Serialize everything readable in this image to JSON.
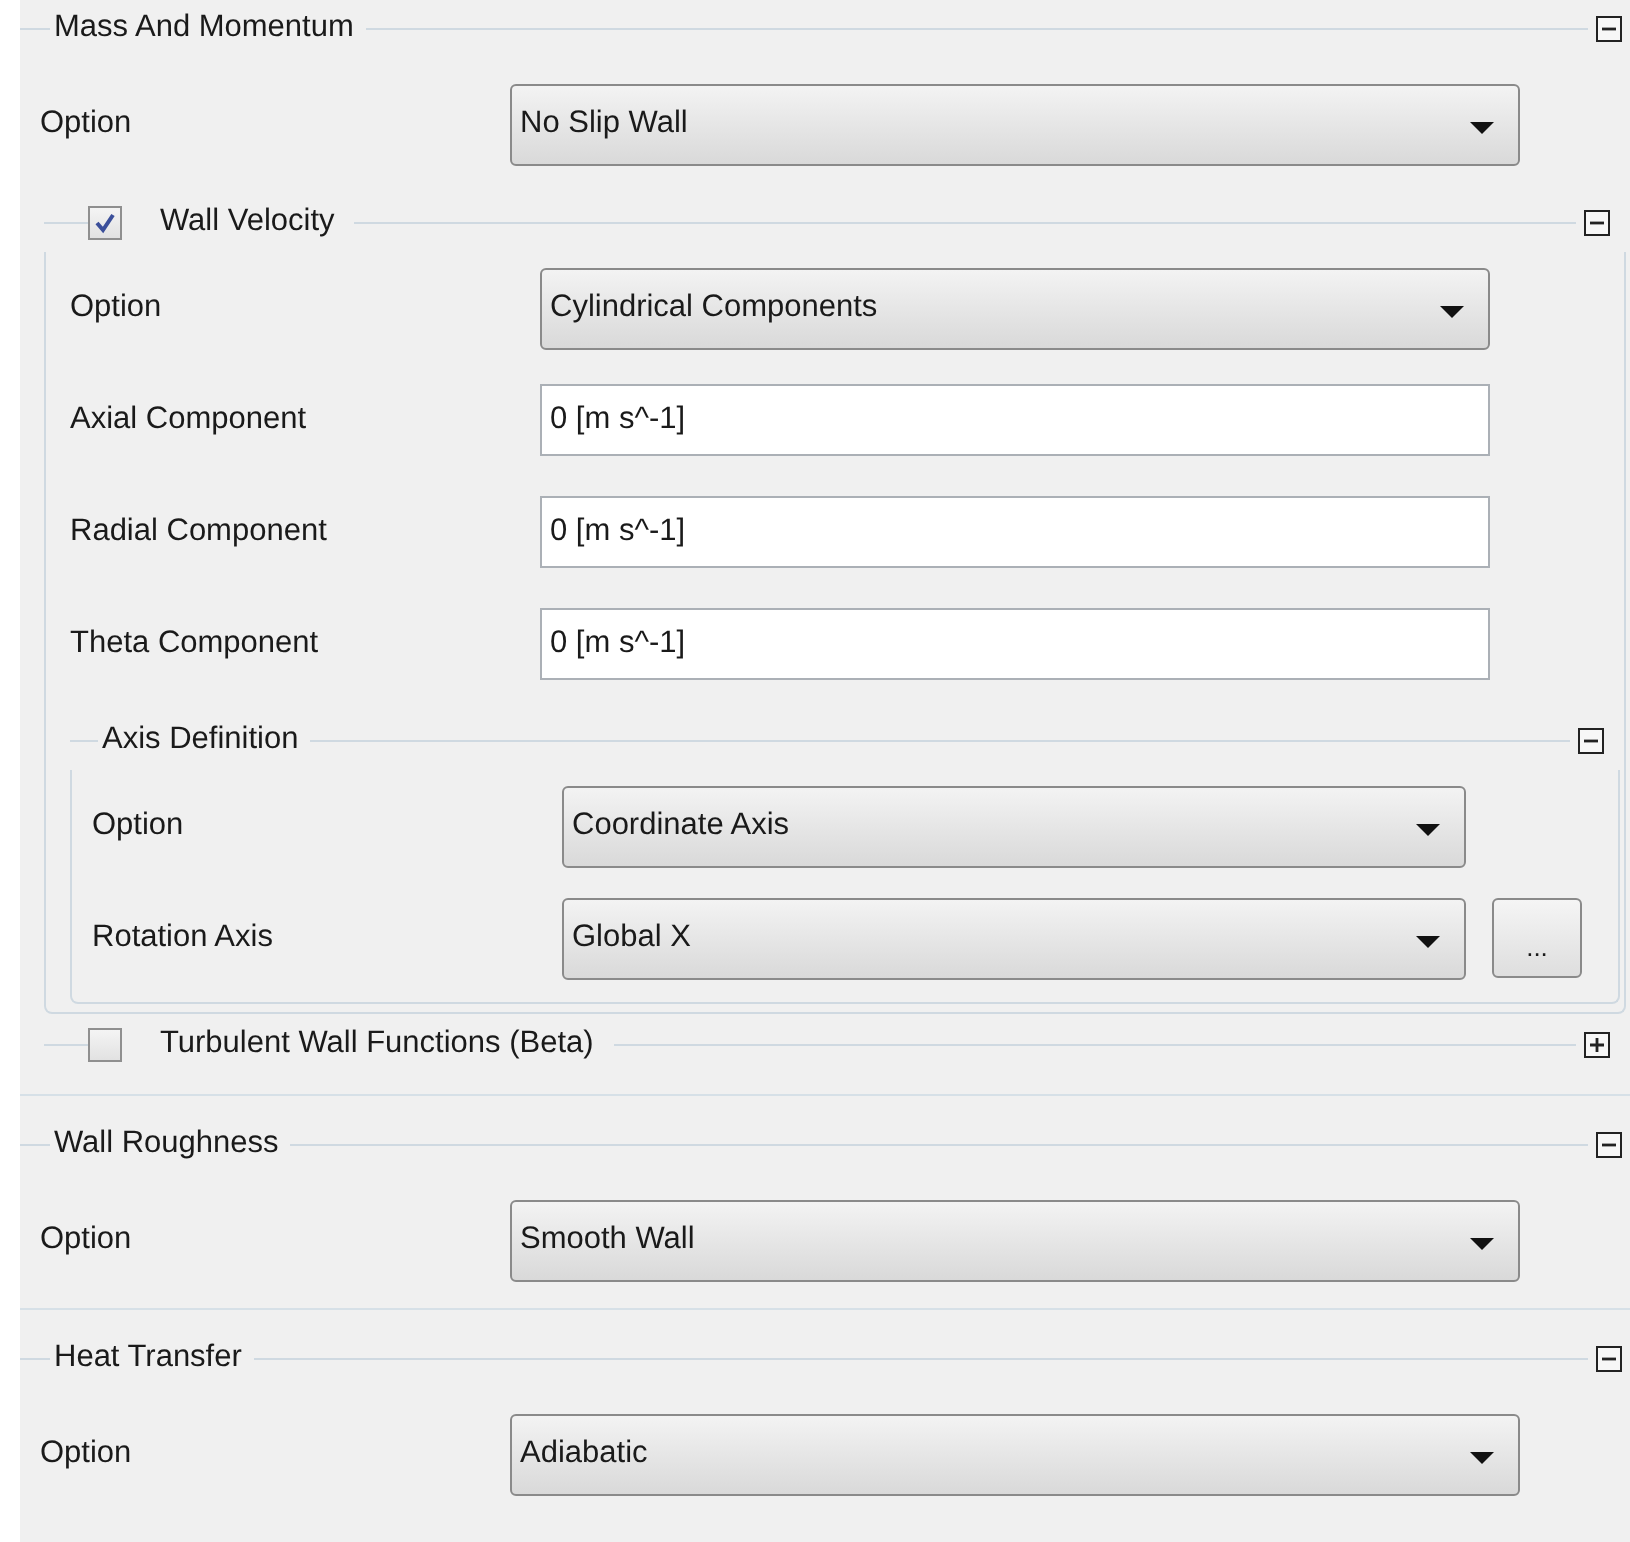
{
  "sections": [
    {
      "title": "Mass And Momentum",
      "expanded": true,
      "items": [
        {
          "kind": "dropdown",
          "label": "Option",
          "value": "No Slip Wall"
        },
        {
          "kind": "group",
          "title": "Wall Velocity",
          "checked": true,
          "expanded": true,
          "items": [
            {
              "kind": "dropdown",
              "label": "Option",
              "value": "Cylindrical Components"
            },
            {
              "kind": "field",
              "label": "Axial Component",
              "value": "0 [m s^-1]"
            },
            {
              "kind": "field",
              "label": "Radial Component",
              "value": "0 [m s^-1]"
            },
            {
              "kind": "field",
              "label": "Theta Component",
              "value": "0 [m s^-1]"
            },
            {
              "kind": "group",
              "title": "Axis Definition",
              "expanded": true,
              "items": [
                {
                  "kind": "dropdown",
                  "label": "Option",
                  "value": "Coordinate Axis"
                },
                {
                  "kind": "dropdown",
                  "label": "Rotation Axis",
                  "value": "Global X",
                  "button": "..."
                }
              ]
            }
          ]
        },
        {
          "kind": "group",
          "title": "Turbulent Wall Functions (Beta)",
          "checked": false,
          "expanded": false
        }
      ]
    },
    {
      "title": "Wall Roughness",
      "expanded": true,
      "items": [
        {
          "kind": "dropdown",
          "label": "Option",
          "value": "Smooth Wall"
        }
      ]
    },
    {
      "title": "Heat Transfer",
      "expanded": true,
      "items": [
        {
          "kind": "dropdown",
          "label": "Option",
          "value": "Adiabatic"
        }
      ]
    }
  ]
}
